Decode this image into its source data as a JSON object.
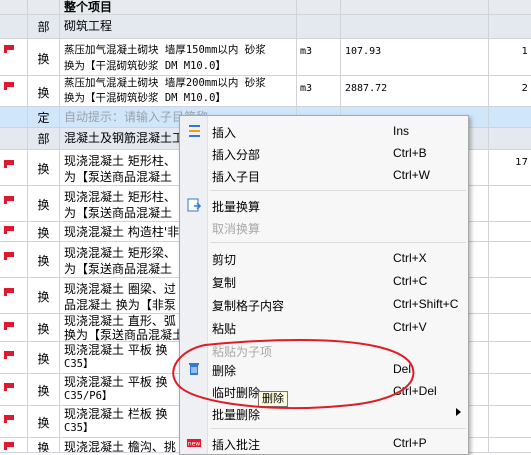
{
  "grid": {
    "header_title": "整个项目",
    "section1": {
      "type": "部",
      "name": "砌筑工程"
    },
    "row1": {
      "type": "换",
      "line1": "蒸压加气混凝土砌块 墙厚150mm以内 砂浆",
      "line2": "换为【干混砌筑砂浆 DM M10.0】",
      "unit": "m3",
      "qty": "107.93",
      "price": "1"
    },
    "row2": {
      "type": "换",
      "line1": "蒸压加气混凝土砌块 墙厚200mm以内 砂浆",
      "line2": "换为【干混砌筑砂浆 DM M10.0】",
      "unit": "m3",
      "qty": "2887.72",
      "price": "2"
    },
    "row_input": {
      "type": "定",
      "placeholder": "自动提示：请输入子目简称"
    },
    "section2": {
      "type": "部",
      "name": "混凝土及钢筋混凝土工"
    },
    "rows": [
      {
        "type": "换",
        "line1": "现浇混凝土 矩形柱、",
        "line2": "为【泵送商品混凝土",
        "extra": "月",
        "price": "17"
      },
      {
        "type": "换",
        "line1": "现浇混凝土 矩形柱、",
        "line2": "为【泵送商品混凝土"
      },
      {
        "type": "换",
        "line1": "现浇混凝土 构造柱'非"
      },
      {
        "type": "换",
        "line1": "现浇混凝土 矩形梁、",
        "line2": "为【泵送商品混凝土"
      },
      {
        "type": "换",
        "line1": "现浇混凝土 圈梁、过",
        "line2": "品混凝土 换为【非泵"
      },
      {
        "type": "换",
        "line1": "现浇混凝土 直形、弧",
        "line2": "换为【泵送商品混凝土"
      },
      {
        "type": "换",
        "line1": "现浇混凝土 平板 换",
        "line2": "C35】"
      },
      {
        "type": "换",
        "line1": "现浇混凝土 平板 换",
        "line2": "C35/P6】"
      },
      {
        "type": "换",
        "line1": "现浇混凝土 栏板 换",
        "line2": "C35】"
      },
      {
        "type": "换",
        "line1": "现浇混凝土 檐沟、挑"
      }
    ]
  },
  "menu": {
    "items": [
      {
        "label": "插入",
        "key": "Ins"
      },
      {
        "label": "插入分部",
        "key": "Ctrl+B"
      },
      {
        "label": "插入子目",
        "key": "Ctrl+W"
      },
      {
        "label": "批量换算",
        "key": ""
      },
      {
        "label": "取消换算",
        "key": ""
      },
      {
        "label": "剪切",
        "key": "Ctrl+X"
      },
      {
        "label": "复制",
        "key": "Ctrl+C"
      },
      {
        "label": "复制格子内容",
        "key": "Ctrl+Shift+C"
      },
      {
        "label": "粘贴",
        "key": "Ctrl+V"
      },
      {
        "label": "粘贴为子项",
        "key": ""
      },
      {
        "label": "删除",
        "key": "Del"
      },
      {
        "label": "临时删除",
        "key": "Ctrl+Del"
      },
      {
        "label": "批量删除",
        "key": ""
      },
      {
        "label": "插入批注",
        "key": "Ctrl+P"
      }
    ]
  },
  "tooltip": "删除",
  "colors": {
    "flag_red": "#e0182d",
    "annotation_red": "#e01c24",
    "icon_blue": "#2f7ad6"
  }
}
